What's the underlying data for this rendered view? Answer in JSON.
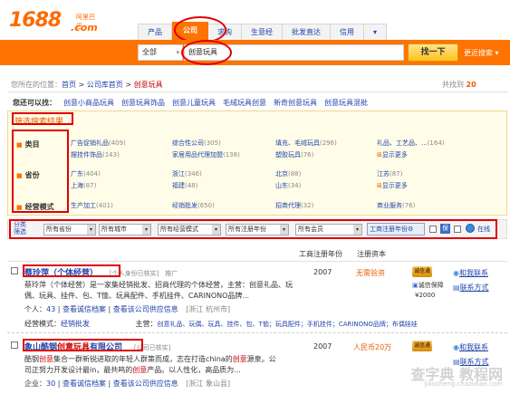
{
  "header": {
    "logo_text": "1688",
    "logo_cn": "阿里巴巴",
    "logo_com": ".com",
    "tabs": [
      "产品",
      "公司",
      "求购",
      "生意经",
      "批发直达",
      "信用",
      "▾"
    ],
    "active_tab": "公司",
    "search_category": "全部",
    "search_query": "创意玩具",
    "search_button": "找一下",
    "more_link": "更近搜索 ▾"
  },
  "breadcrumb": {
    "prefix": "您所在的位置：",
    "home": "首页",
    "sep": ">",
    "level2": "公司库首页",
    "current": "创意玩具",
    "total_prefix": "共找到",
    "total_count": "20"
  },
  "also_search": {
    "label": "您还可以找：",
    "items": [
      "创意小商品玩具",
      "创意玩具饰品",
      "创意儿童玩具",
      "毛绒玩具创意",
      "新奇创意玩具",
      "创意玩具混批"
    ]
  },
  "filter_panel": {
    "title": "筛选搜索结果",
    "category_label": "类目",
    "categories": [
      {
        "name": "广告促销礼品",
        "count": "(409)"
      },
      {
        "name": "综合性公司",
        "count": "(305)"
      },
      {
        "name": "填充、毛绒玩具",
        "count": "(296)"
      },
      {
        "name": "礼品、工艺品、...",
        "count": "(164)"
      },
      {
        "name": "摆挂件饰品",
        "count": "(143)"
      },
      {
        "name": "家居用品代理加盟",
        "count": "(138)"
      },
      {
        "name": "塑胶玩具",
        "count": "(76)"
      },
      {
        "name": "显示更多",
        "count": ""
      }
    ],
    "province_label": "省份",
    "provinces": [
      {
        "name": "广东",
        "count": "(404)"
      },
      {
        "name": "浙江",
        "count": "(346)"
      },
      {
        "name": "北京",
        "count": "(88)"
      },
      {
        "name": "江苏",
        "count": "(87)"
      },
      {
        "name": "上海",
        "count": "(87)"
      },
      {
        "name": "福建",
        "count": "(48)"
      },
      {
        "name": "山东",
        "count": "(34)"
      },
      {
        "name": "显示更多",
        "count": ""
      }
    ],
    "biz_label": "经营模式",
    "biz_modes": [
      {
        "name": "生产加工",
        "count": "(401)"
      },
      {
        "name": "经销批发",
        "count": "(650)"
      },
      {
        "name": "招商代理",
        "count": "(32)"
      },
      {
        "name": "商业服务",
        "count": "(76)"
      }
    ]
  },
  "filter_bar": {
    "label_line1": "分类",
    "label_line2": "筛选",
    "dropdowns": [
      "所有省份",
      "所有城市",
      "所有经营模式",
      "所有注册年份",
      "所有会员"
    ],
    "btn_year": "工商注册年份",
    "online_label": "在线"
  },
  "columns": {
    "reg_year": "工商注册年份",
    "reg_capital": "注册资本"
  },
  "listings": [
    {
      "title_pre": "蔡玲萍（个体经营）",
      "tag": "[个人身份已核实]",
      "extra": "推广",
      "desc_1": "蔡玲萍（个体经营）是一家集经销批发、招商代理的个体经营，主营：创意礼品、玩",
      "desc_2": "偶、玩具、挂件、包、T恤、玩具配件、手机挂件、CARINONO品牌...",
      "stats_1": "个人：",
      "stats_1v": "43",
      "stats_2": "查看诚信档案",
      "stats_3": "查看该公司供应信息",
      "location": "[浙江 杭州市]",
      "mode_label": "经营模式：",
      "mode": "经销批发",
      "main_label": "主营：",
      "main_value": "创意礼品、玩偶、玩具、挂件、包、T恤；玩具配件；手机挂件；CARINONO品牌；布偶娃娃",
      "year": "2007",
      "capital": "无需验资",
      "badge": "诚信通",
      "guarantee": "诚信保障",
      "deposit": "¥2000",
      "contact": "和我联系",
      "contact2": "联系方式"
    },
    {
      "title_pre": "象山酷钢",
      "title_hl": "创意玩具",
      "title_post": "有限公司",
      "tag": "[公司已核实]",
      "desc_1a": "酷钢",
      "desc_1b": "创意",
      "desc_1c": "集合一群新锐进取的年轻人群策而成，志在打造china的",
      "desc_1d": "创意",
      "desc_1e": "源泉。公",
      "desc_2a": "司正努力开发设计最in，最共鸣的",
      "desc_2b": "创意",
      "desc_2c": "产品。以人性化，高品质为...",
      "stats_1": "企业：",
      "stats_1v": "30",
      "stats_2": "查看诚信档案",
      "stats_3": "查看该公司供应信息",
      "location": "[浙江 象山县]",
      "year": "2007",
      "capital": "人民币20万",
      "badge": "诚信通",
      "contact": "和我联系",
      "contact2": "联系方式"
    }
  ],
  "watermark": {
    "main": "查字典 教程网",
    "sub": "jiaocheng.chazidian.com"
  },
  "colors": {
    "accent": "#ff7300",
    "highlight": "#cc0000",
    "link": "#2244aa"
  }
}
